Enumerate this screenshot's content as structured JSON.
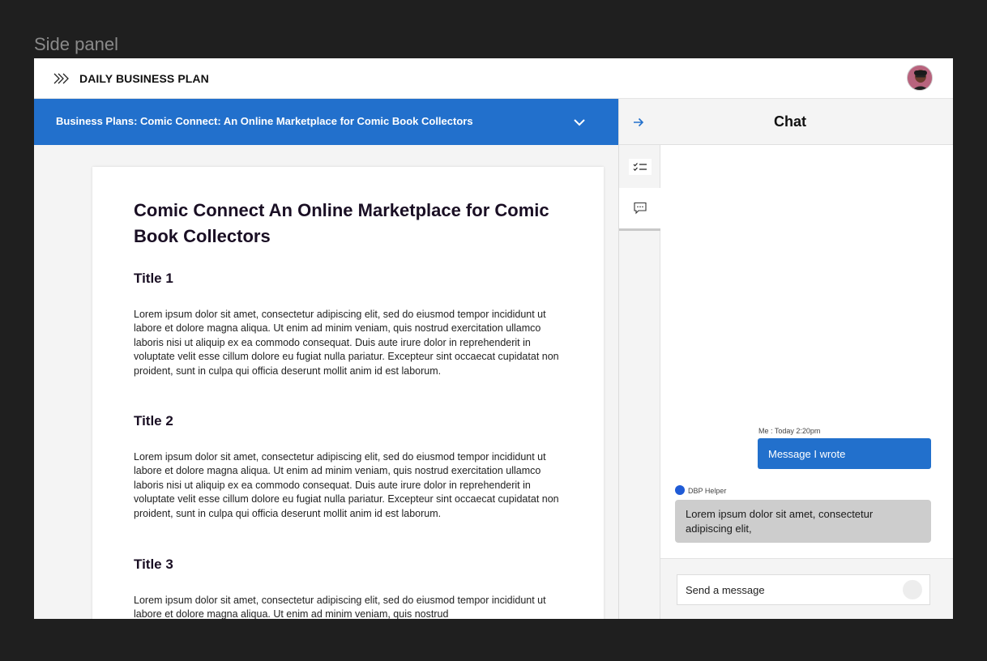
{
  "frame": {
    "label": "Side panel"
  },
  "header": {
    "app_title": "DAILY BUSINESS PLAN",
    "logo_icon": "double-chevron-right-icon",
    "avatar": "user-avatar"
  },
  "plan_bar": {
    "title": "Business Plans: Comic Connect: An Online Marketplace for Comic Book Collectors",
    "expand_icon": "chevron-down-icon"
  },
  "document": {
    "title": "Comic Connect An Online Marketplace for Comic Book Collectors",
    "sections": [
      {
        "title": "Title 1",
        "body": "Lorem ipsum dolor sit amet, consectetur adipiscing elit, sed do eiusmod tempor incididunt ut labore et dolore magna aliqua. Ut enim ad minim veniam, quis nostrud exercitation ullamco laboris nisi ut aliquip ex ea commodo consequat. Duis aute irure dolor in reprehenderit in voluptate velit esse cillum dolore eu fugiat nulla pariatur. Excepteur sint occaecat cupidatat non proident, sunt in culpa qui officia deserunt mollit anim id est laborum."
      },
      {
        "title": "Title 2",
        "body": "Lorem ipsum dolor sit amet, consectetur adipiscing elit, sed do eiusmod tempor incididunt ut labore et dolore magna aliqua. Ut enim ad minim veniam, quis nostrud exercitation ullamco laboris nisi ut aliquip ex ea commodo consequat. Duis aute irure dolor in reprehenderit in voluptate velit esse cillum dolore eu fugiat nulla pariatur. Excepteur sint occaecat cupidatat non proident, sunt in culpa qui officia deserunt mollit anim id est laborum."
      },
      {
        "title": "Title 3",
        "body": "Lorem ipsum dolor sit amet, consectetur adipiscing elit, sed do eiusmod tempor incididunt ut labore et dolore magna aliqua. Ut enim ad minim veniam, quis nostrud"
      }
    ]
  },
  "chat": {
    "title": "Chat",
    "collapse_icon": "arrow-right-icon",
    "rail": {
      "checklist_icon": "checklist-icon",
      "chat_icon": "chat-bubble-icon"
    },
    "messages": [
      {
        "meta": "Me : Today 2:20pm",
        "text": "Message I wrote"
      },
      {
        "meta": "DBP Helper",
        "text": "Lorem ipsum dolor sit amet, consectetur adipiscing elit,"
      }
    ],
    "composer": {
      "placeholder": "Send a message",
      "value": ""
    }
  },
  "colors": {
    "accent": "#2270cc",
    "helper_bubble": "#cdcdcd",
    "helper_dot": "#1f5bd6",
    "background": "#1f1f1f"
  }
}
